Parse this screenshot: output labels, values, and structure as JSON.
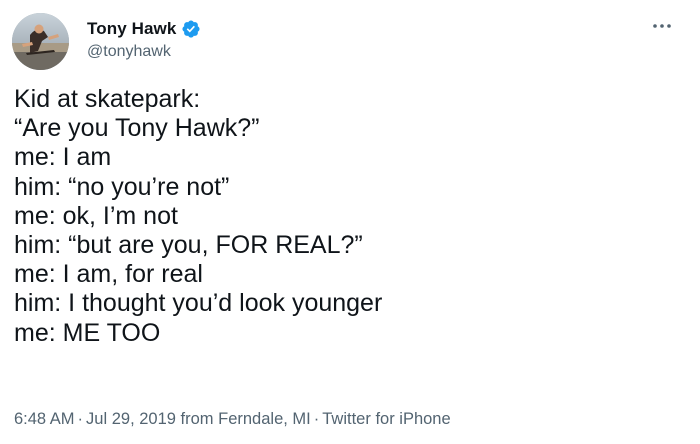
{
  "author": {
    "display_name": "Tony Hawk",
    "handle": "@tonyhawk",
    "verified": true,
    "verified_color": "#1d9bf0"
  },
  "menu": {
    "icon": "more-horizontal-icon"
  },
  "tweet": {
    "lines": [
      "Kid at skatepark:",
      "“Are you Tony Hawk?”",
      "me: I am",
      "him: “no you’re not”",
      "me: ok, I’m not",
      "him: “but are you, FOR REAL?”",
      "me: I am, for real",
      "him: I thought you’d look younger",
      "me: ME TOO"
    ]
  },
  "meta": {
    "time": "6:48 AM",
    "date": "Jul 29, 2019",
    "location": "from Ferndale, MI",
    "source": "Twitter for iPhone",
    "separator": "·"
  },
  "colors": {
    "text": "#0f1419",
    "secondary": "#536471"
  }
}
